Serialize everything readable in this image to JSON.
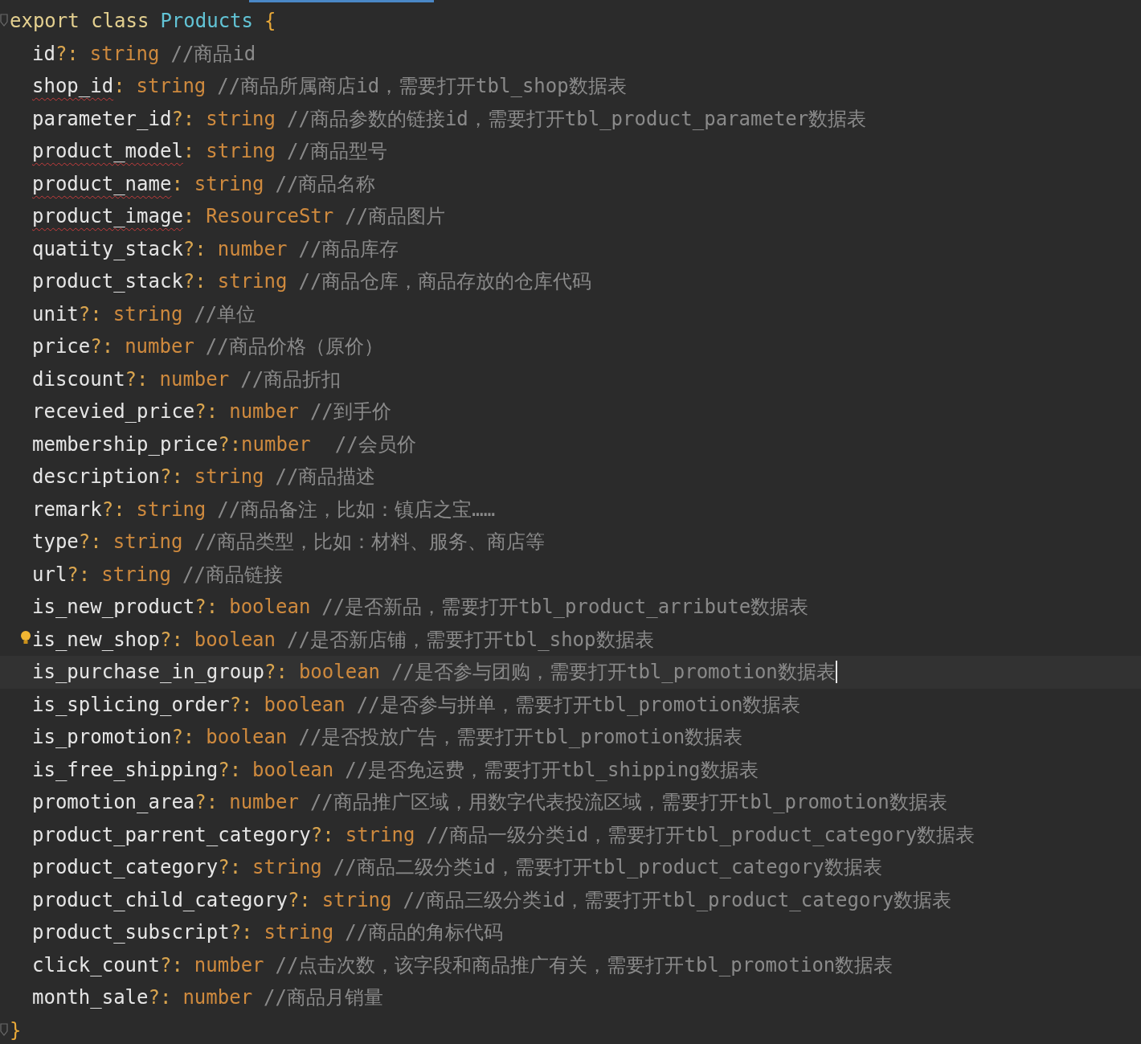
{
  "editor": {
    "header": {
      "keywords": "export class",
      "class_name": "Products",
      "open_brace": "{"
    },
    "fields": [
      {
        "name": "id",
        "punct": "?:",
        "type": "string",
        "comment": "//商品id",
        "warning": false,
        "hint": false,
        "current": false,
        "tight": false
      },
      {
        "name": "shop_id",
        "punct": ":",
        "type": "string",
        "comment": "//商品所属商店id，需要打开tbl_shop数据表",
        "warning": true,
        "hint": false,
        "current": false,
        "tight": false
      },
      {
        "name": "parameter_id",
        "punct": "?:",
        "type": "string",
        "comment": "//商品参数的链接id，需要打开tbl_product_parameter数据表",
        "warning": false,
        "hint": false,
        "current": false,
        "tight": false
      },
      {
        "name": "product_model",
        "punct": ":",
        "type": "string",
        "comment": "//商品型号",
        "warning": true,
        "hint": false,
        "current": false,
        "tight": false
      },
      {
        "name": "product_name",
        "punct": ":",
        "type": "string",
        "comment": "//商品名称",
        "warning": true,
        "hint": false,
        "current": false,
        "tight": false
      },
      {
        "name": "product_image",
        "punct": ":",
        "type": "ResourceStr",
        "comment": "//商品图片",
        "warning": true,
        "hint": false,
        "current": false,
        "tight": false
      },
      {
        "name": "quatity_stack",
        "punct": "?:",
        "type": "number",
        "comment": "//商品库存",
        "warning": false,
        "hint": false,
        "current": false,
        "tight": false
      },
      {
        "name": "product_stack",
        "punct": "?:",
        "type": "string",
        "comment": "//商品仓库，商品存放的仓库代码",
        "warning": false,
        "hint": false,
        "current": false,
        "tight": false
      },
      {
        "name": "unit",
        "punct": "?:",
        "type": "string",
        "comment": "//单位",
        "warning": false,
        "hint": false,
        "current": false,
        "tight": false
      },
      {
        "name": "price",
        "punct": "?:",
        "type": "number",
        "comment": "//商品价格（原价）",
        "warning": false,
        "hint": false,
        "current": false,
        "tight": false
      },
      {
        "name": "discount",
        "punct": "?:",
        "type": "number",
        "comment": "//商品折扣",
        "warning": false,
        "hint": false,
        "current": false,
        "tight": false
      },
      {
        "name": "recevied_price",
        "punct": "?:",
        "type": "number",
        "comment": "//到手价",
        "warning": false,
        "hint": false,
        "current": false,
        "tight": false
      },
      {
        "name": "membership_price",
        "punct": "?:",
        "type": "number",
        "comment": "//会员价",
        "warning": false,
        "hint": false,
        "current": false,
        "tight": true
      },
      {
        "name": "description",
        "punct": "?:",
        "type": "string",
        "comment": "//商品描述",
        "warning": false,
        "hint": false,
        "current": false,
        "tight": false
      },
      {
        "name": "remark",
        "punct": "?:",
        "type": "string",
        "comment": "//商品备注，比如：镇店之宝……",
        "warning": false,
        "hint": false,
        "current": false,
        "tight": false
      },
      {
        "name": "type",
        "punct": "?:",
        "type": "string",
        "comment": "//商品类型，比如：材料、服务、商店等",
        "warning": false,
        "hint": false,
        "current": false,
        "tight": false
      },
      {
        "name": "url",
        "punct": "?:",
        "type": "string",
        "comment": "//商品链接",
        "warning": false,
        "hint": false,
        "current": false,
        "tight": false
      },
      {
        "name": "is_new_product",
        "punct": "?:",
        "type": "boolean",
        "comment": "//是否新品，需要打开tbl_product_arribute数据表",
        "warning": false,
        "hint": false,
        "current": false,
        "tight": false
      },
      {
        "name": "is_new_shop",
        "punct": "?:",
        "type": "boolean",
        "comment": "//是否新店铺，需要打开tbl_shop数据表",
        "warning": false,
        "hint": true,
        "current": false,
        "tight": false
      },
      {
        "name": "is_purchase_in_group",
        "punct": "?:",
        "type": "boolean",
        "comment": "//是否参与团购，需要打开tbl_promotion数据表",
        "warning": false,
        "hint": false,
        "current": true,
        "tight": false
      },
      {
        "name": "is_splicing_order",
        "punct": "?:",
        "type": "boolean",
        "comment": "//是否参与拼单，需要打开tbl_promotion数据表",
        "warning": false,
        "hint": false,
        "current": false,
        "tight": false
      },
      {
        "name": "is_promotion",
        "punct": "?:",
        "type": "boolean",
        "comment": "//是否投放广告，需要打开tbl_promotion数据表",
        "warning": false,
        "hint": false,
        "current": false,
        "tight": false
      },
      {
        "name": "is_free_shipping",
        "punct": "?:",
        "type": "boolean",
        "comment": "//是否免运费，需要打开tbl_shipping数据表",
        "warning": false,
        "hint": false,
        "current": false,
        "tight": false
      },
      {
        "name": "promotion_area",
        "punct": "?:",
        "type": "number",
        "comment": "//商品推广区域，用数字代表投流区域，需要打开tbl_promotion数据表",
        "warning": false,
        "hint": false,
        "current": false,
        "tight": false
      },
      {
        "name": "product_parrent_category",
        "punct": "?:",
        "type": "string",
        "comment": "//商品一级分类id，需要打开tbl_product_category数据表",
        "warning": false,
        "hint": false,
        "current": false,
        "tight": false
      },
      {
        "name": "product_category",
        "punct": "?:",
        "type": "string",
        "comment": "//商品二级分类id，需要打开tbl_product_category数据表",
        "warning": false,
        "hint": false,
        "current": false,
        "tight": false
      },
      {
        "name": "product_child_category",
        "punct": "?:",
        "type": "string",
        "comment": "//商品三级分类id，需要打开tbl_product_category数据表",
        "warning": false,
        "hint": false,
        "current": false,
        "tight": false
      },
      {
        "name": "product_subscript",
        "punct": "?:",
        "type": "string",
        "comment": "//商品的角标代码",
        "warning": false,
        "hint": false,
        "current": false,
        "tight": false
      },
      {
        "name": "click_count",
        "punct": "?:",
        "type": "number",
        "comment": "//点击次数，该字段和商品推广有关，需要打开tbl_promotion数据表",
        "warning": false,
        "hint": false,
        "current": false,
        "tight": false
      },
      {
        "name": "month_sale",
        "punct": "?:",
        "type": "number",
        "comment": "//商品月销量",
        "warning": false,
        "hint": false,
        "current": false,
        "tight": false
      }
    ],
    "close_brace": "}"
  }
}
